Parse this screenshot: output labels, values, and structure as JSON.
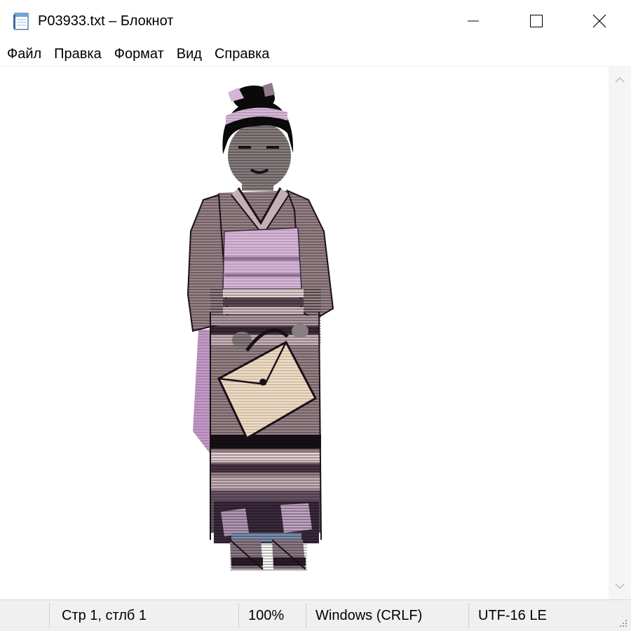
{
  "window": {
    "title": "P03933.txt – Блокнот",
    "icons": {
      "app": "notepad-icon",
      "minimize": "minimize-icon",
      "maximize": "maximize-icon",
      "close": "close-icon"
    }
  },
  "menu": {
    "items": [
      {
        "label": "Файл"
      },
      {
        "label": "Правка"
      },
      {
        "label": "Формат"
      },
      {
        "label": "Вид"
      },
      {
        "label": "Справка"
      }
    ]
  },
  "editor": {
    "content_image": "ascii-art-girl-in-kimono-holding-handbag"
  },
  "scrollbar": {
    "up_icon": "chevron-up-icon",
    "down_icon": "chevron-down-icon"
  },
  "status": {
    "position": "Стр 1, стлб 1",
    "zoom": "100%",
    "line_ending": "Windows (CRLF)",
    "encoding": "UTF-16 LE"
  },
  "colors": {
    "kimono_mauve": "#9a8489",
    "obi_lilac": "#d8b6d9",
    "bag_cream": "#f0dcc4",
    "hair_black": "#0a0a0a",
    "skin": "#8a7f80",
    "dark_purple": "#3a2a3c",
    "accent_pink": "#c49ac9"
  }
}
